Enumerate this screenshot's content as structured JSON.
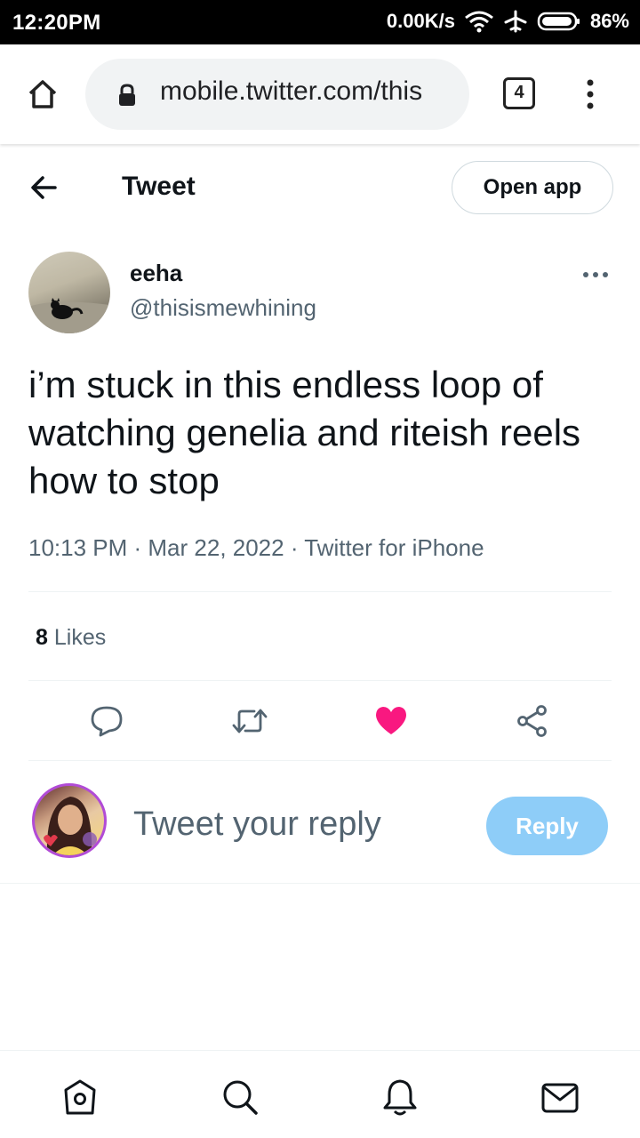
{
  "status_bar": {
    "time": "12:20PM",
    "network_speed": "0.00K/s",
    "battery": "86%",
    "icons": [
      "wifi-icon",
      "airplane-icon",
      "battery-icon"
    ]
  },
  "browser": {
    "url": "mobile.twitter.com/this",
    "tab_count": "4",
    "icons": [
      "home-icon",
      "lock-icon",
      "overflow-menu-icon"
    ]
  },
  "header": {
    "title": "Tweet",
    "open_app_label": "Open app"
  },
  "tweet": {
    "author_name": "eeha",
    "author_handle": "@thisismewhining",
    "text": "i’m stuck in this endless loop of watching genelia and riteish reels how to stop",
    "meta": "10:13 PM · Mar 22, 2022 · Twitter for iPhone",
    "likes_count": "8",
    "likes_label": "Likes",
    "liked": true
  },
  "actions": [
    "reply-icon",
    "retweet-icon",
    "like-icon",
    "share-icon"
  ],
  "reply": {
    "placeholder": "Tweet your reply",
    "button_label": "Reply"
  },
  "bottom_nav": [
    "home-icon",
    "search-icon",
    "notifications-icon",
    "messages-icon"
  ],
  "colors": {
    "like": "#f91880",
    "reply_button": "#8ecdf8",
    "secondary_text": "#536471"
  }
}
